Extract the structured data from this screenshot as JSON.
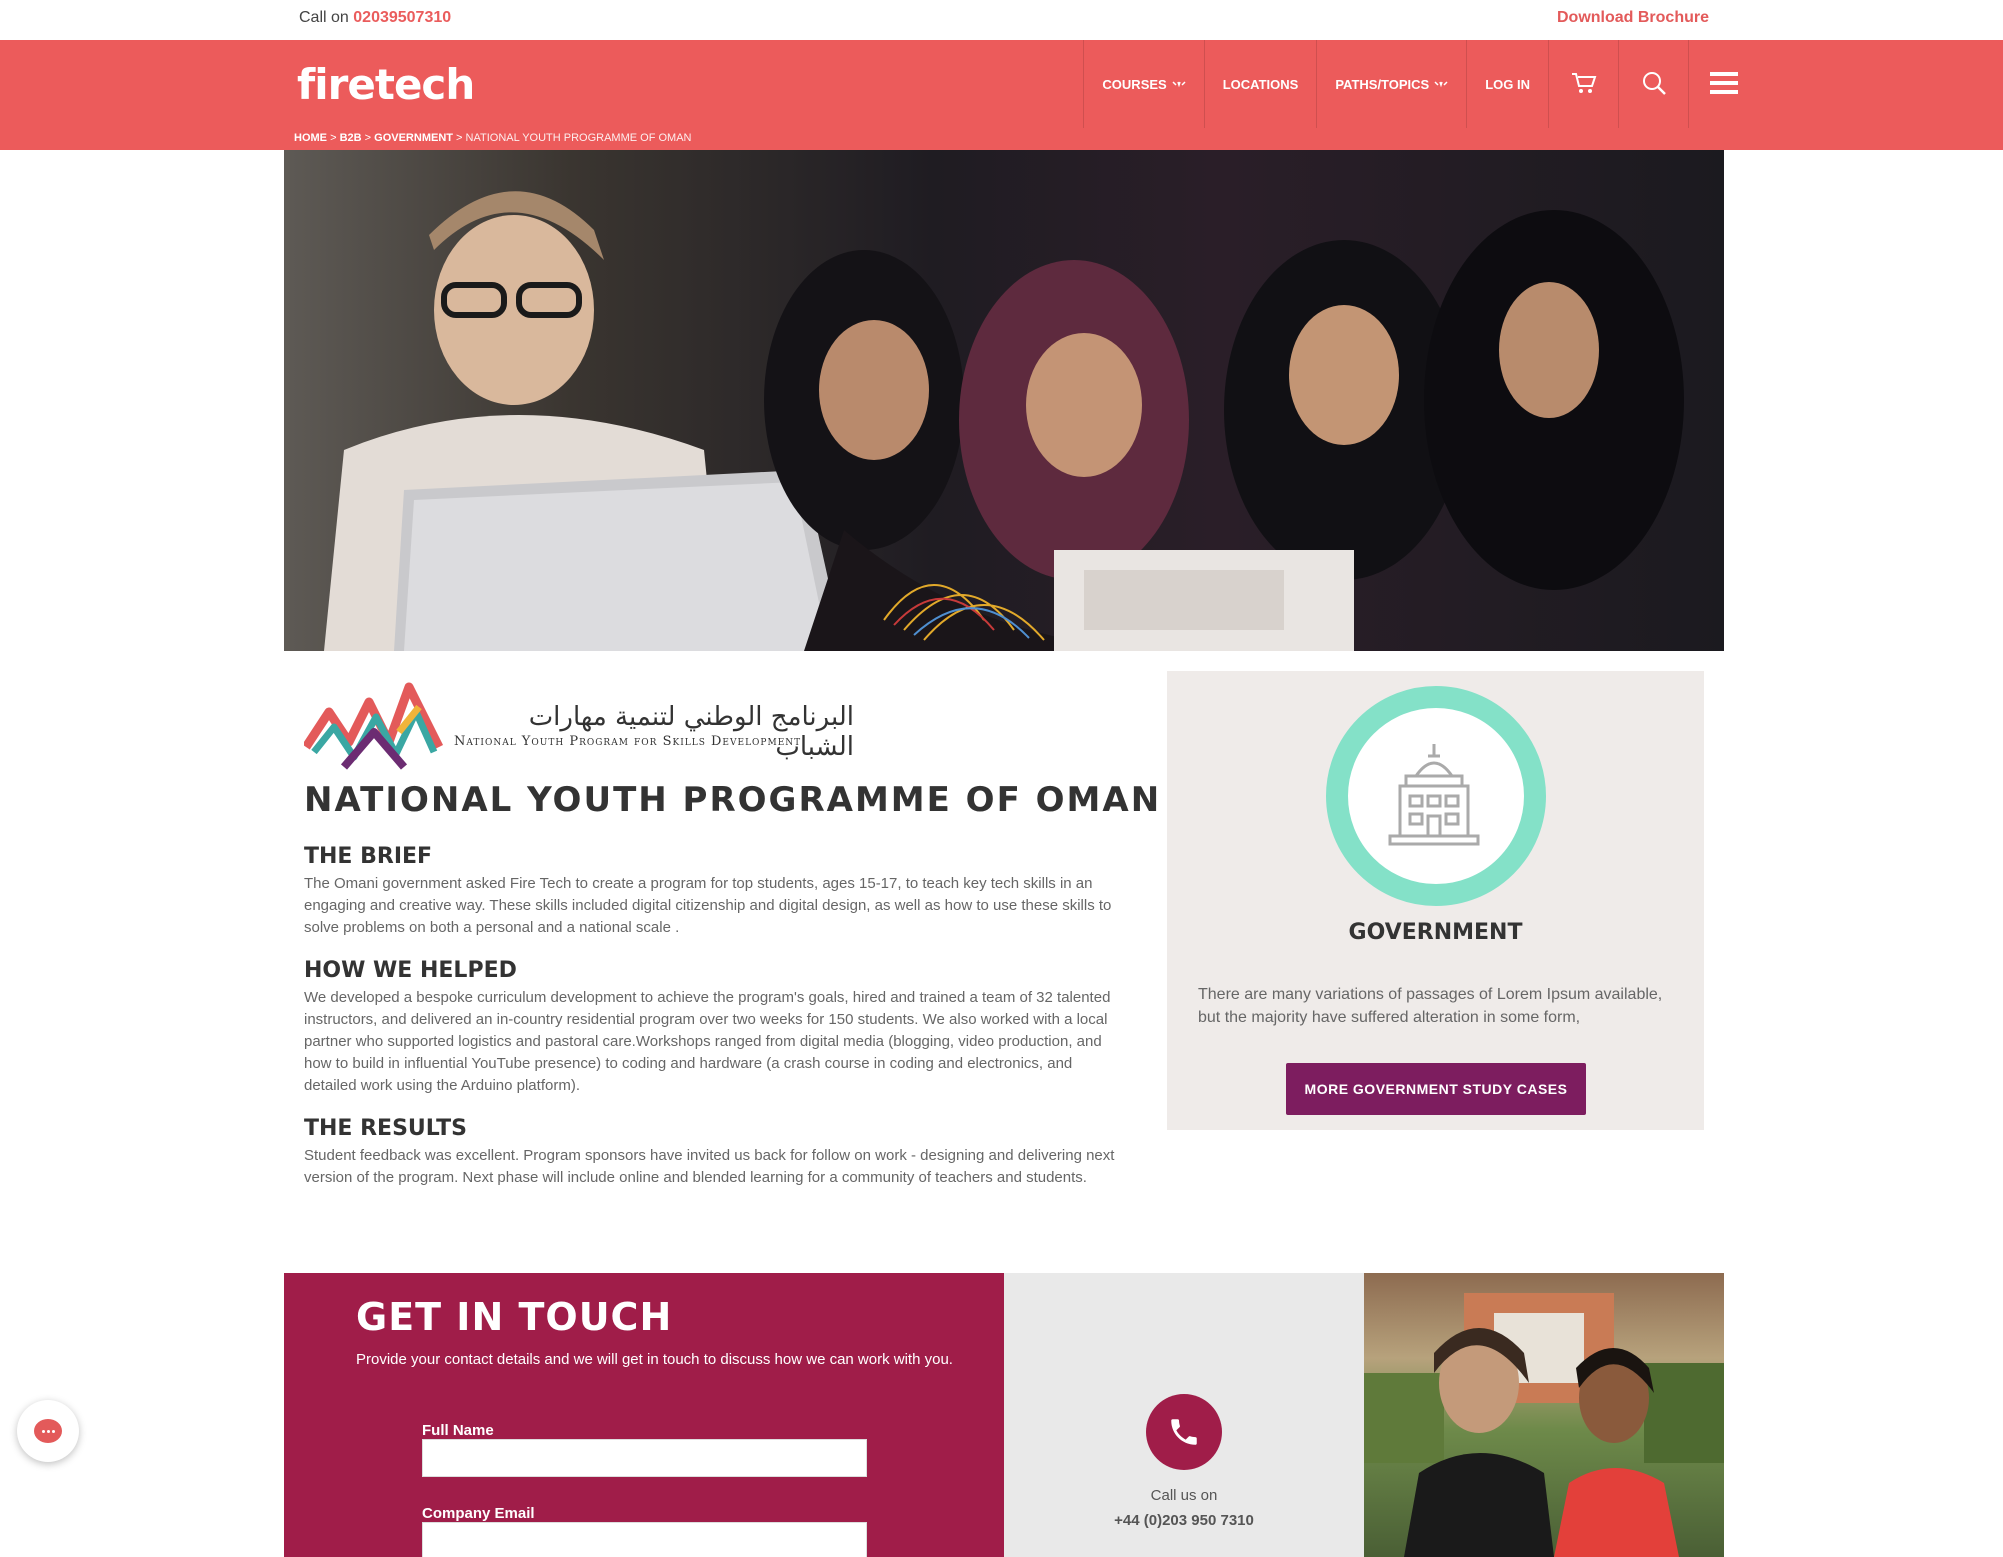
{
  "topbar": {
    "call_prefix": "Call on",
    "call_number": "02039507310",
    "download_label": "Download Brochure"
  },
  "header": {
    "logo_text": "firetech",
    "nav": {
      "courses": "COURSES",
      "locations": "LOCATIONS",
      "paths": "PATHS/TOPICS",
      "login": "LOG IN"
    },
    "icons": {
      "cart": "cart-icon",
      "search": "search-icon",
      "menu": "hamburger-menu-icon"
    }
  },
  "breadcrumb": {
    "home": "HOME",
    "b2b": "B2B",
    "government": "GOVERNMENT",
    "current": "NATIONAL YOUTH PROGRAMME OF OMAN",
    "separator": ">"
  },
  "programme_logo": {
    "arabic": "البرنامج الوطني لتنمية مهارات الشباب",
    "english": "National Youth Program for Skills Development"
  },
  "main": {
    "title": "NATIONAL YOUTH PROGRAMME OF OMAN",
    "brief_heading": "THE BRIEF",
    "brief_text": "The Omani government asked Fire Tech to create a program for top students, ages 15-17, to teach key tech skills in an engaging and creative way. These skills included digital citizenship and digital design, as well as how to use these skills to solve problems on both a personal and a national scale .",
    "helped_heading": "HOW WE HELPED",
    "helped_text": "We developed a bespoke curriculum development to achieve the program's goals, hired and trained a team of 32 talented instructors, and delivered an in-country residential program over two weeks for 150 students. We also worked with a local partner who supported logistics and pastoral care.Workshops ranged from digital media (blogging, video production, and how to build in influential YouTube presence) to coding and hardware (a crash course in coding and electronics, and detailed work using the Arduino platform).",
    "results_heading": "THE RESULTS",
    "results_text": "Student feedback was excellent. Program sponsors have invited us back for follow on work - designing and delivering next version of the program. Next phase will include online and blended learning for a community of teachers and students."
  },
  "sidebar_card": {
    "icon": "government-building-icon",
    "title": "GOVERNMENT",
    "text": "There are many variations of passages of Lorem Ipsum available, but the majority have suffered alteration in some form,",
    "button_label": "MORE GOVERNMENT STUDY CASES"
  },
  "contact": {
    "heading": "GET IN TOUCH",
    "intro": "Provide your contact details and we will get in touch to discuss how we can work with you.",
    "full_name_label": "Full Name",
    "full_name_value": "",
    "company_email_label": "Company Email",
    "company_email_value": "",
    "call_label": "Call us on",
    "call_number": "+44 (0)203 950 7310"
  },
  "colors": {
    "brand_red": "#ec5b5b",
    "accent_purple": "#7d1d5f",
    "contact_crimson": "#a01d49",
    "mint": "#84e1c8"
  }
}
